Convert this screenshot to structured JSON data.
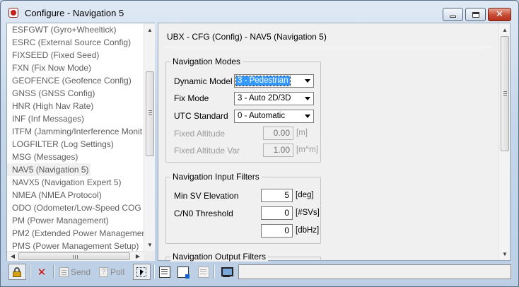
{
  "window": {
    "title": "Configure - Navigation 5",
    "close_glyph": "✕"
  },
  "message_list": {
    "items": [
      "ESFGWT (Gyro+Wheeltick)",
      "ESRC (External Source Config)",
      "FIXSEED (Fixed Seed)",
      "FXN (Fix Now Mode)",
      "GEOFENCE (Geofence Config)",
      "GNSS (GNSS Config)",
      "HNR (High Nav Rate)",
      "INF (Inf Messages)",
      "ITFM (Jamming/Interference Monit",
      "LOGFILTER (Log Settings)",
      "MSG (Messages)",
      "NAV5 (Navigation 5)",
      "NAVX5 (Navigation Expert 5)",
      "NMEA (NMEA Protocol)",
      "ODO (Odometer/Low-Speed COG f",
      "PM (Power Management)",
      "PM2 (Extended Power Managemen",
      "PMS (Power Management Setup)"
    ],
    "selected": "NAV5 (Navigation 5)"
  },
  "config": {
    "header": "UBX - CFG (Config) - NAV5 (Navigation 5)",
    "navigation_modes": {
      "title": "Navigation Modes",
      "dynamic_model": {
        "label": "Dynamic Model",
        "value": "3 - Pedestrian"
      },
      "fix_mode": {
        "label": "Fix Mode",
        "value": "3 - Auto 2D/3D"
      },
      "utc_standard": {
        "label": "UTC Standard",
        "value": "0 - Automatic"
      },
      "fixed_altitude": {
        "label": "Fixed Altitude",
        "value": "0.00",
        "unit": "[m]"
      },
      "fixed_altitude_var": {
        "label": "Fixed Altitude Var",
        "value": "1.00",
        "unit": "[m^m]"
      }
    },
    "navigation_input_filters": {
      "title": "Navigation Input Filters",
      "min_sv_elevation": {
        "label": "Min SV Elevation",
        "value": "5",
        "unit": "[deg]"
      },
      "cn0_threshold": {
        "label": "C/N0 Threshold",
        "value": "0",
        "unit": "[#SVs]"
      },
      "cn0_threshold_dbhz": {
        "value": "0",
        "unit": "[dbHz]"
      }
    },
    "navigation_output_filters": {
      "title": "Navigation Output Filters"
    }
  },
  "toolbar": {
    "send_label": "Send",
    "poll_label": "Poll",
    "status_text": ""
  },
  "icons": [
    "app-icon",
    "minimize-icon",
    "maximize-icon",
    "close-icon",
    "lock-icon",
    "delete-x-icon",
    "send-icon",
    "poll-icon",
    "auto-poll-icon",
    "load-icon",
    "save-icon",
    "revert-icon",
    "connect-icon",
    "scroll-up-icon",
    "scroll-down-icon",
    "scroll-left-icon",
    "scroll-right-icon",
    "dropdown-arrow-icon"
  ]
}
